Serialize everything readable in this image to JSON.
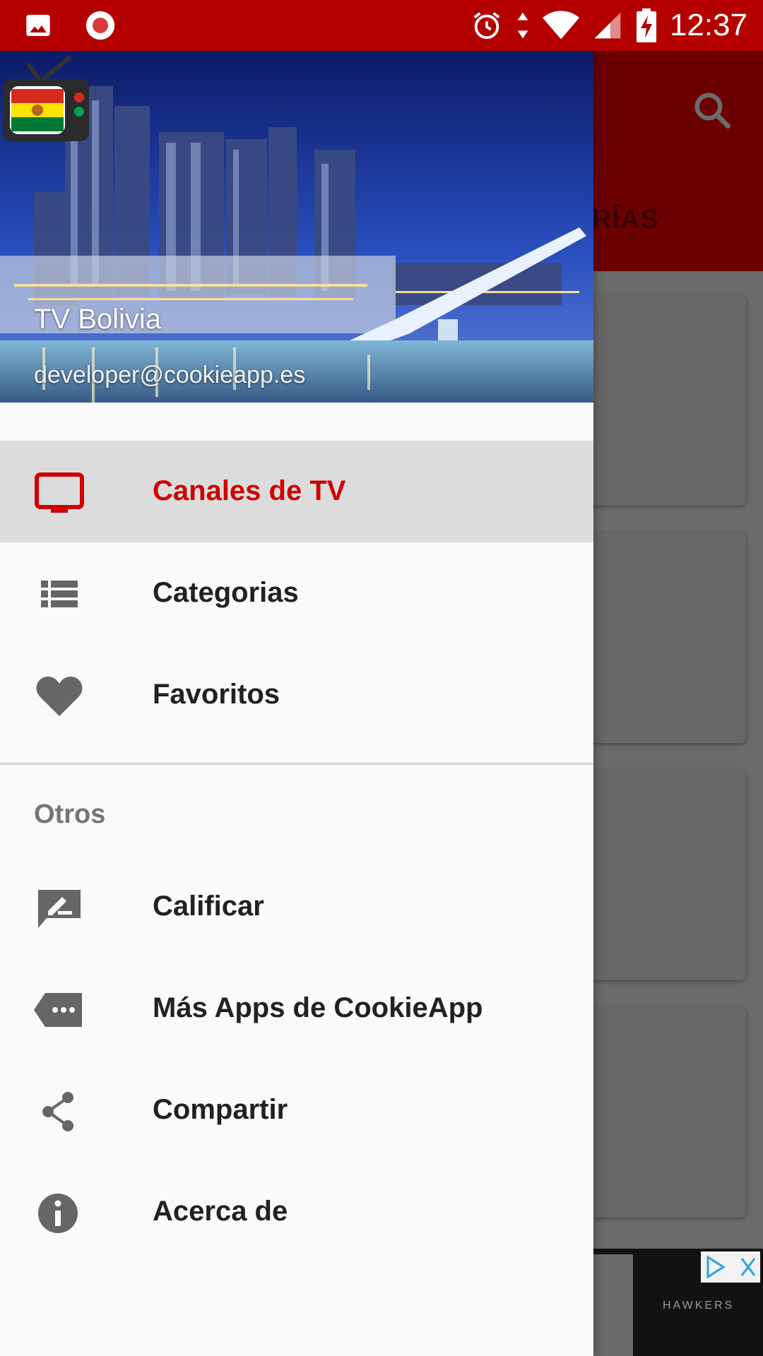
{
  "status_bar": {
    "time": "12:37",
    "left_icons": [
      "image-icon",
      "record-icon"
    ],
    "right_icons": [
      "alarm-icon",
      "data-arrows-icon",
      "wifi-icon",
      "signal-icon",
      "battery-charging-icon"
    ]
  },
  "background": {
    "tab_fragment": "RÍAS",
    "ad_brand": "HAWKERS"
  },
  "drawer": {
    "header": {
      "app_name": "TV Bolivia",
      "email": "developer@cookieapp.es"
    },
    "items": [
      {
        "label": "Canales de TV",
        "icon": "tv-icon",
        "active": true
      },
      {
        "label": "Categorias",
        "icon": "list-icon",
        "active": false
      },
      {
        "label": "Favoritos",
        "icon": "heart-icon",
        "active": false
      }
    ],
    "section_title": "Otros",
    "other_items": [
      {
        "label": "Calificar",
        "icon": "rate-review-icon"
      },
      {
        "label": "Más Apps de CookieApp",
        "icon": "more-tag-icon"
      },
      {
        "label": "Compartir",
        "icon": "share-icon"
      },
      {
        "label": "Acerca de",
        "icon": "info-icon"
      }
    ]
  },
  "colors": {
    "status_bar": "#b50000",
    "active_label": "#d00000",
    "icon_grey": "#666666"
  }
}
